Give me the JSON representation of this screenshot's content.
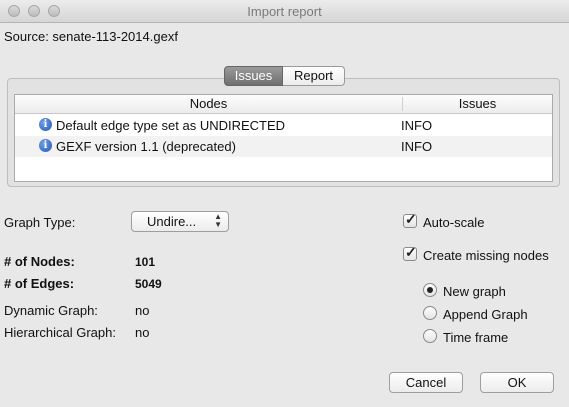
{
  "window": {
    "title": "Import report"
  },
  "source": {
    "text": "Source: senate-113-2014.gexf"
  },
  "tabs": [
    {
      "label": "Issues",
      "active": true
    },
    {
      "label": "Report",
      "active": false
    }
  ],
  "issues_table": {
    "columns": [
      "Nodes",
      "Issues"
    ],
    "rows": [
      {
        "icon": "info-icon",
        "name": "Default edge type set as UNDIRECTED",
        "issue": "INFO"
      },
      {
        "icon": "info-icon",
        "name": "GEXF version 1.1 (deprecated)",
        "issue": "INFO"
      }
    ]
  },
  "graph_type": {
    "label": "Graph Type:",
    "selected": "Undire..."
  },
  "stats": {
    "nodes_label": "# of Nodes:",
    "nodes_value": "101",
    "edges_label": "# of Edges:",
    "edges_value": "5049",
    "dynamic_label": "Dynamic Graph:",
    "dynamic_value": "no",
    "hierarchical_label": "Hierarchical Graph:",
    "hierarchical_value": "no"
  },
  "options": {
    "auto_scale": {
      "label": "Auto-scale",
      "checked": true
    },
    "create_missing": {
      "label": "Create missing nodes",
      "checked": true
    },
    "radios": [
      {
        "label": "New graph",
        "selected": true
      },
      {
        "label": "Append Graph",
        "selected": false
      },
      {
        "label": "Time frame",
        "selected": false
      }
    ]
  },
  "buttons": {
    "cancel": "Cancel",
    "ok": "OK"
  }
}
